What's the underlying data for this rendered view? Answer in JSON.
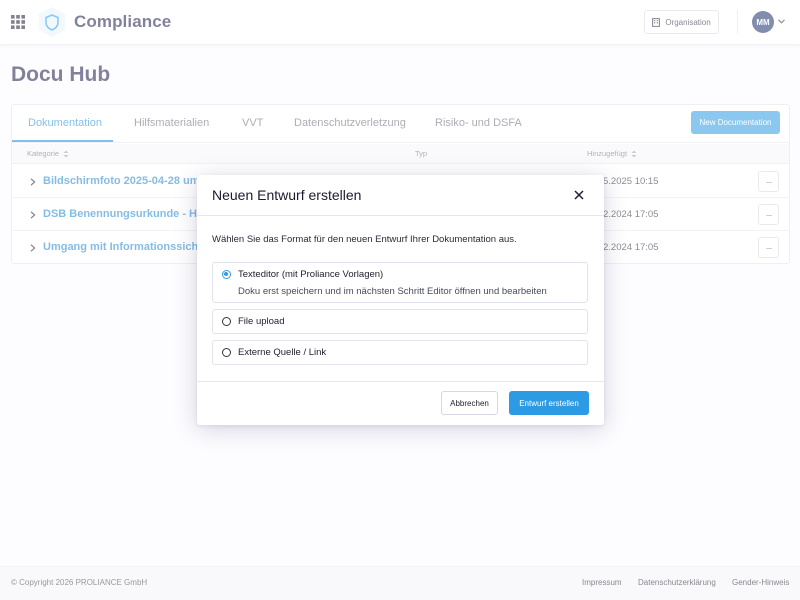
{
  "header": {
    "app_name": "Compliance",
    "organisation_label": "Organisation",
    "avatar_initials": "MM"
  },
  "page": {
    "title": "Docu Hub"
  },
  "tabs": [
    {
      "label": "Dokumentation",
      "active": true
    },
    {
      "label": "Hilfsmaterialien",
      "active": false
    },
    {
      "label": "VVT",
      "active": false
    },
    {
      "label": "Datenschutzverletzung",
      "active": false
    },
    {
      "label": "Risiko- und DSFA",
      "active": false
    }
  ],
  "new_document_label": "New Documentation",
  "table": {
    "columns": [
      "Kategorie",
      "Typ",
      "Hinzugefügt"
    ],
    "rows": [
      {
        "title": "Bildschirmfoto 2025-04-28 um 1",
        "added": "5.2025 10:15"
      },
      {
        "title": "DSB Benennungsurkunde - Hrist",
        "added": "2.2024 17:05"
      },
      {
        "title": "Umgang mit Informationssicher",
        "added": "2.2024 17:05"
      }
    ],
    "more_label": "···"
  },
  "modal": {
    "title": "Neuen Entwurf erstellen",
    "description": "Wählen Sie das Format für den neuen Entwurf Ihrer Dokumentation aus.",
    "options": [
      {
        "label": "Texteditor (mit Proliance Vorlagen)",
        "sub": "Doku erst speichern und im nächsten Schritt Editor öffnen und bearbeiten",
        "selected": true
      },
      {
        "label": "File upload",
        "selected": false
      },
      {
        "label": "Externe Quelle / Link",
        "selected": false
      }
    ],
    "cancel_label": "Abbrechen",
    "create_label": "Entwurf erstellen"
  },
  "footer": {
    "copyright": "© Copyright 2026 PROLIANCE GmbH",
    "links": [
      "Impressum",
      "Datenschutzerklärung",
      "Gender-Hinweis"
    ]
  },
  "colors": {
    "accent": "#2d9be3",
    "brand_dark": "#1c1a4a",
    "link_blue": "#1f86cf",
    "avatar_bg": "#1c2f6b"
  },
  "icons": [
    "apps-grid-icon",
    "compliance-logo-icon",
    "building-icon",
    "chevron-down-icon",
    "sort-icon",
    "chevron-right-icon",
    "more-icon",
    "close-icon"
  ]
}
